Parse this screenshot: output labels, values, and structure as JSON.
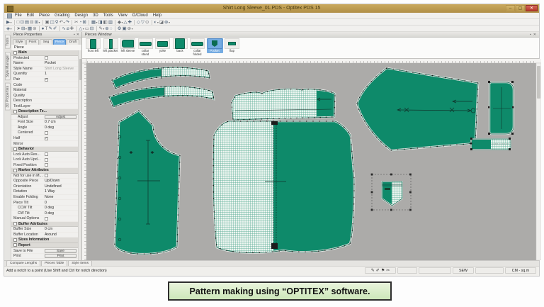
{
  "window": {
    "title": "Shirt Long Sleeve_01.PDS - Optitex PDS 15",
    "controls": {
      "minimize": "–",
      "maximize": "▢",
      "close": "✕"
    }
  },
  "menu": {
    "items": [
      "File",
      "Edit",
      "Piece",
      "Grading",
      "Design",
      "3D",
      "Tools",
      "View",
      "O/Cloud",
      "Help"
    ]
  },
  "toolbar1": {
    "icons": [
      {
        "g": "▶",
        "drop": true
      },
      {
        "sep": true
      },
      {
        "g": "□"
      },
      {
        "g": "⊡"
      },
      {
        "g": "▤"
      },
      {
        "g": "⊟"
      },
      {
        "g": "⊞",
        "drop": true
      },
      {
        "sep": true
      },
      {
        "g": "▣"
      },
      {
        "g": "◫"
      },
      {
        "g": "⚲"
      },
      {
        "g": "↶",
        "drop": true
      },
      {
        "g": "↷"
      },
      {
        "sep": true
      },
      {
        "g": "✂"
      },
      {
        "g": "◔"
      },
      {
        "g": "⊠"
      },
      {
        "sep": true
      },
      {
        "g": "▦",
        "drop": true
      },
      {
        "g": "◨"
      },
      {
        "g": "◧"
      },
      {
        "g": "▥"
      },
      {
        "sep": true
      },
      {
        "g": "◆",
        "drop": true
      },
      {
        "g": "△"
      },
      {
        "g": "✚"
      },
      {
        "sep": true
      },
      {
        "g": "◇"
      },
      {
        "g": "▽"
      },
      {
        "g": "⊙"
      },
      {
        "sep": true
      },
      {
        "g": "◐",
        "drop": true
      },
      {
        "g": "◪"
      },
      {
        "g": "⊕",
        "drop": true
      }
    ]
  },
  "toolbar2": {
    "icons": [
      {
        "g": "◈",
        "drop": true
      },
      {
        "sep": true
      },
      {
        "g": "➤"
      },
      {
        "g": "⊞",
        "drop": true
      },
      {
        "g": "▦"
      },
      {
        "g": "⊚"
      },
      {
        "sep": true
      },
      {
        "g": "●"
      },
      {
        "g": "T"
      },
      {
        "g": "✎"
      },
      {
        "g": "✐"
      },
      {
        "sep": true
      },
      {
        "g": "∿"
      },
      {
        "g": "⌀"
      },
      {
        "g": "✚"
      },
      {
        "sep": true
      },
      {
        "g": "△",
        "drop": true
      },
      {
        "g": "▭"
      },
      {
        "g": "⊟"
      },
      {
        "sep": true
      },
      {
        "g": "✎",
        "drop": true
      },
      {
        "g": "⊕"
      },
      {
        "g": "◌"
      },
      {
        "sep": true
      },
      {
        "g": "⚙"
      },
      {
        "g": "▣"
      },
      {
        "g": "⊛",
        "drop": true
      }
    ]
  },
  "side_tabs": {
    "items": [
      "Tools",
      "Style Manager",
      "3D Properties"
    ]
  },
  "props": {
    "title": "Piece Properties",
    "pin": "▪",
    "close": "✕",
    "tabs": [
      {
        "label": "Style"
      },
      {
        "label": "Point"
      },
      {
        "label": "Seg"
      },
      {
        "label": "Piece",
        "active": true
      },
      {
        "label": "Draft"
      }
    ],
    "subtitle": "Piece",
    "rows": [
      {
        "type": "section",
        "label": "Main"
      },
      {
        "type": "check",
        "label": "Protected"
      },
      {
        "type": "text",
        "label": "Name",
        "value": "Pocket"
      },
      {
        "type": "text",
        "label": "Style Name",
        "value": "Shirt Long Sleeve",
        "muted": true
      },
      {
        "type": "text",
        "label": "Quantity",
        "value": "1"
      },
      {
        "type": "check",
        "label": "Pair",
        "checked": true
      },
      {
        "type": "text",
        "label": "Code",
        "value": ""
      },
      {
        "type": "text",
        "label": "Material",
        "value": ""
      },
      {
        "type": "text",
        "label": "Quality",
        "value": ""
      },
      {
        "type": "text",
        "label": "Description",
        "value": ""
      },
      {
        "type": "text",
        "label": "Text/Layer",
        "value": ""
      },
      {
        "type": "section",
        "label": "Description Te..."
      },
      {
        "type": "button",
        "label": "Adjust",
        "value": "Adjust",
        "indent": true
      },
      {
        "type": "text",
        "label": "Font Size",
        "value": "0.7 cm",
        "indent": true
      },
      {
        "type": "text",
        "label": "Angle",
        "value": "0 deg",
        "indent": true
      },
      {
        "type": "check",
        "label": "Centered",
        "indent": true
      },
      {
        "type": "check",
        "label": "Half",
        "checked": true
      },
      {
        "type": "text",
        "label": "Mirror",
        "value": "",
        "muted": true
      },
      {
        "type": "section",
        "label": "Behavior"
      },
      {
        "type": "check",
        "label": "Lock Auto Res..."
      },
      {
        "type": "check",
        "label": "Lock Auto Upd..."
      },
      {
        "type": "check",
        "label": "Fixed Position"
      },
      {
        "type": "section",
        "label": "Marker Attributes"
      },
      {
        "type": "check",
        "label": "Not for use in M..."
      },
      {
        "type": "text",
        "label": "Opposite Piece",
        "value": "Up/Down"
      },
      {
        "type": "text",
        "label": "Orientation",
        "value": "Undefined"
      },
      {
        "type": "text",
        "label": "Rotation",
        "value": "1 Way"
      },
      {
        "type": "text",
        "label": "Enable Folding",
        "value": "None"
      },
      {
        "type": "text",
        "label": "Piece Tilt",
        "value": "0"
      },
      {
        "type": "text",
        "label": "CCW Tilt",
        "value": "0 deg",
        "indent": true
      },
      {
        "type": "text",
        "label": "CW Tilt",
        "value": "0 deg",
        "indent": true
      },
      {
        "type": "check",
        "label": "Manual Options"
      },
      {
        "type": "section",
        "label": "Buffer Attributes"
      },
      {
        "type": "text",
        "label": "Buffer Size",
        "value": "0 cm"
      },
      {
        "type": "text",
        "label": "Buffer Location",
        "value": "Around"
      },
      {
        "type": "section",
        "label": "Sizes Information"
      },
      {
        "type": "section",
        "label": "Report"
      },
      {
        "type": "button",
        "label": "Save to File",
        "value": "Save"
      },
      {
        "type": "button",
        "label": "Print",
        "value": "Print"
      }
    ]
  },
  "pieces": {
    "title": "Pieces Window",
    "pin": "▪",
    "close": "✕",
    "items": [
      {
        "label": "front left",
        "shape": "front"
      },
      {
        "label": "left placket",
        "shape": "placket"
      },
      {
        "label": "left sleeve",
        "shape": "sleeve"
      },
      {
        "label": "collar stand",
        "shape": "collar"
      },
      {
        "label": "yoke",
        "shape": "yoke"
      },
      {
        "label": "back",
        "shape": "back"
      },
      {
        "label": "collar folded",
        "shape": "collar"
      },
      {
        "label": "Pocket",
        "shape": "pocket",
        "selected": true
      },
      {
        "label": "flap",
        "shape": "flap"
      }
    ]
  },
  "bottom_tabs": {
    "items": [
      "Compare Lengths",
      "Pieces Table",
      "Style Items"
    ]
  },
  "status": {
    "message": "Add a notch to a point (Use Shift and Ctrl for notch direction)",
    "icons": [
      "✎",
      "✐",
      "⚑",
      "✂"
    ],
    "sew": "SEW",
    "units": "CM - sq.m"
  },
  "caption": {
    "text": "Pattern making using “OPTITEX” software."
  },
  "colors": {
    "accent_teal": "#0e8a6a",
    "titlebar_tan": "#bd9d52",
    "selection_blue": "#74abe2",
    "canvas_gray": "#acaba9"
  }
}
